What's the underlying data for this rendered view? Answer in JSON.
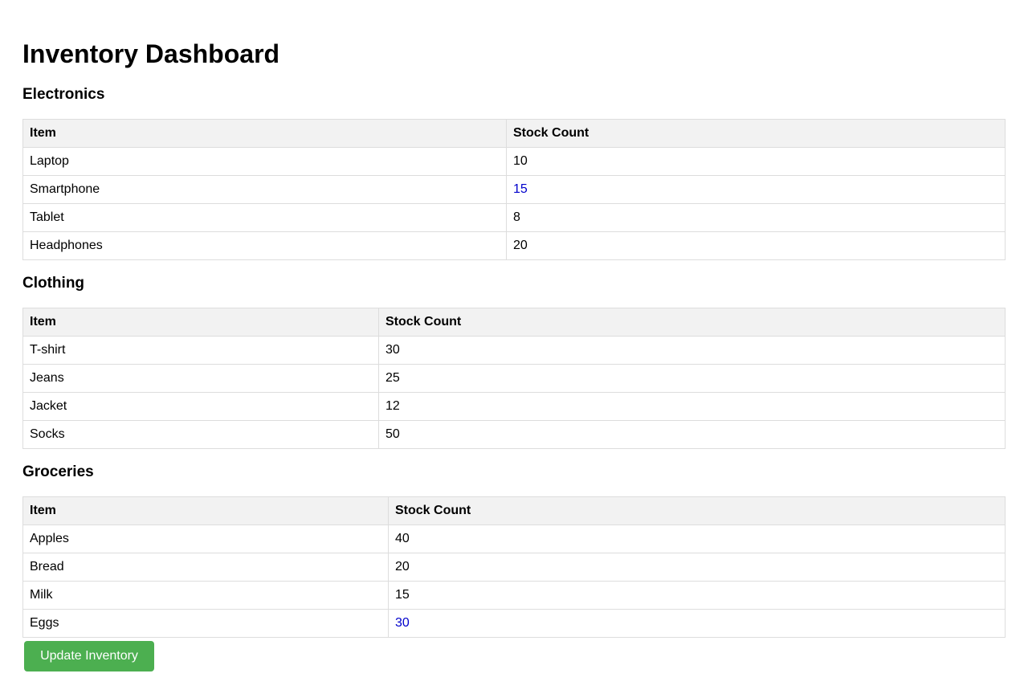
{
  "page": {
    "title": "Inventory Dashboard"
  },
  "columns": {
    "item": "Item",
    "stock": "Stock Count"
  },
  "sections": [
    {
      "title": "Electronics",
      "rows": [
        {
          "item": "Laptop",
          "stock": "10",
          "highlight": false
        },
        {
          "item": "Smartphone",
          "stock": "15",
          "highlight": true
        },
        {
          "item": "Tablet",
          "stock": "8",
          "highlight": false
        },
        {
          "item": "Headphones",
          "stock": "20",
          "highlight": false
        }
      ]
    },
    {
      "title": "Clothing",
      "rows": [
        {
          "item": "T-shirt",
          "stock": "30",
          "highlight": false
        },
        {
          "item": "Jeans",
          "stock": "25",
          "highlight": false
        },
        {
          "item": "Jacket",
          "stock": "12",
          "highlight": false
        },
        {
          "item": "Socks",
          "stock": "50",
          "highlight": false
        }
      ]
    },
    {
      "title": "Groceries",
      "rows": [
        {
          "item": "Apples",
          "stock": "40",
          "highlight": false
        },
        {
          "item": "Bread",
          "stock": "20",
          "highlight": false
        },
        {
          "item": "Milk",
          "stock": "15",
          "highlight": false
        },
        {
          "item": "Eggs",
          "stock": "30",
          "highlight": true
        }
      ]
    }
  ],
  "actions": {
    "update_label": "Update Inventory"
  },
  "colors": {
    "header_bg": "#f2f2f2",
    "border": "#dddddd",
    "highlight_text": "#0000cc",
    "button_bg": "#4caf50",
    "button_text": "#ffffff"
  }
}
